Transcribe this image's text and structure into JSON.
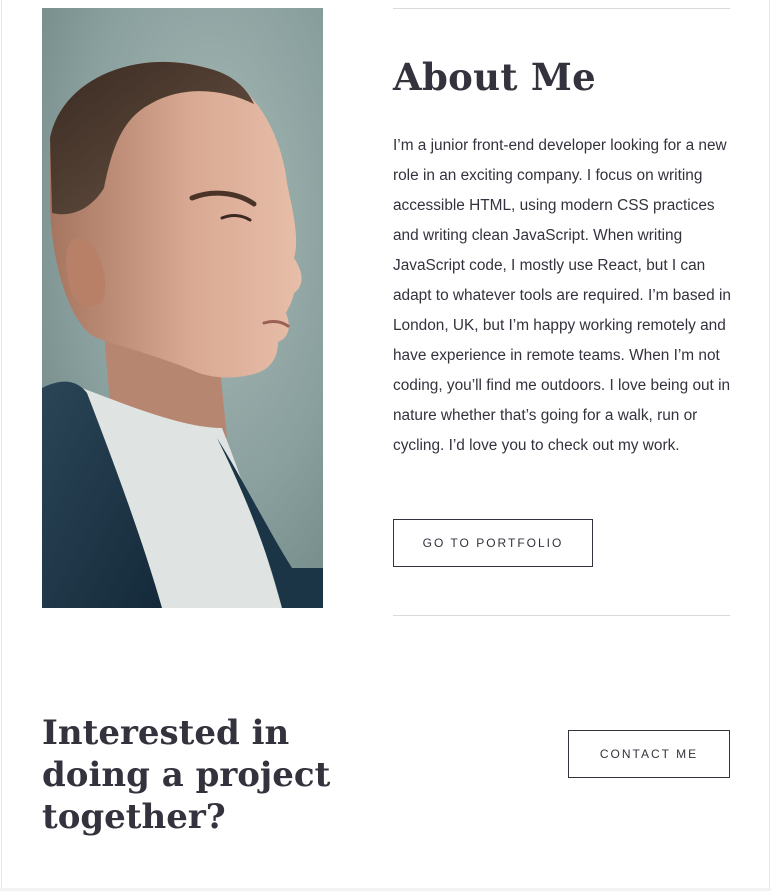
{
  "about": {
    "title": "About Me",
    "body": "I’m a junior front-end developer looking for a new role in an exciting company. I focus on writing accessible HTML, using modern CSS practices and writing clean JavaScript. When writing JavaScript code, I mostly use React, but I can adapt to whatever tools are required. I’m based in London, UK, but I’m happy working remotely and have experience in remote teams. When I’m not coding, you’ll find me outdoors. I love being out in nature whether that’s going for a walk, run or cycling. I’d love you to check out my work.",
    "button_label": "GO TO PORTFOLIO"
  },
  "cta": {
    "title": "Interested in doing a project together?",
    "button_label": "CONTACT ME"
  },
  "colors": {
    "text": "#33323D",
    "divider": "#D9DADD",
    "background": "#FFFFFF",
    "photo_backdrop": "#8FA4A3"
  }
}
